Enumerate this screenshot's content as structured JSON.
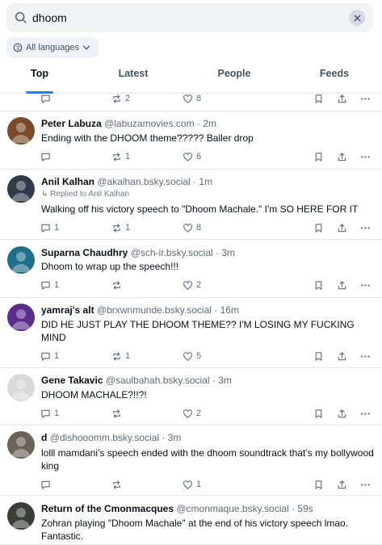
{
  "search": {
    "query": "dhoom",
    "placeholder": "Search"
  },
  "language_filter": {
    "label": "All languages"
  },
  "tabs": [
    {
      "label": "Top",
      "active": true
    },
    {
      "label": "Latest",
      "active": false
    },
    {
      "label": "People",
      "active": false
    },
    {
      "label": "Feeds",
      "active": false
    }
  ],
  "top_partial": {
    "reposts": "2",
    "likes": "8"
  },
  "posts": [
    {
      "name": "Peter Labuza",
      "handle": "@labuzamovies.com",
      "time": "2m",
      "reply_to": "",
      "text": "Ending with the DHOOM theme????? Baller drop",
      "replies": "",
      "reposts": "1",
      "likes": "6",
      "avatar_color": "#7a4b2a"
    },
    {
      "name": "Anil Kalhan",
      "handle": "@akalhan.bsky.social",
      "time": "1m",
      "reply_to": "Replied to Anil Kalhan",
      "text": "Walking off his victory speech to \"Dhoom Machale.\" I'm SO HERE FOR IT",
      "replies": "1",
      "reposts": "1",
      "likes": "8",
      "avatar_color": "#2f3b4a"
    },
    {
      "name": "Suparna Chaudhry",
      "handle": "@sch-ir.bsky.social",
      "time": "3m",
      "reply_to": "",
      "text": "Dhoom to wrap up the speech!!!",
      "replies": "1",
      "reposts": "",
      "likes": "2",
      "avatar_color": "#1f6f8b"
    },
    {
      "name": "yamraj's alt",
      "handle": "@brxwnmunde.bsky.social",
      "time": "16m",
      "reply_to": "",
      "text": "DID HE JUST PLAY THE DHOOM THEME?? I'M LOSING MY FUCKING MIND",
      "replies": "1",
      "reposts": "1",
      "likes": "5",
      "avatar_color": "#5a2d8a"
    },
    {
      "name": "Gene Takavic",
      "handle": "@saulbahah.bsky.social",
      "time": "3m",
      "reply_to": "",
      "text": "DHOOM MACHALE?!!?!",
      "replies": "1",
      "reposts": "",
      "likes": "2",
      "avatar_color": "#d9d9d9"
    },
    {
      "name": "d",
      "handle": "@dishooomm.bsky.social",
      "time": "3m",
      "reply_to": "",
      "text": "lolll mamdani’s speech ended with the dhoom soundtrack that’s my bollywood king",
      "replies": "",
      "reposts": "",
      "likes": "1",
      "avatar_color": "#6b6258"
    },
    {
      "name": "Return of the Cmonmacques",
      "handle": "@cmonmaque.bsky.social",
      "time": "59s",
      "reply_to": "",
      "text": "Zohran playing \"Dhoom Machale\" at the end of his victory speech lmao. Fantastic.",
      "replies": "",
      "reposts": "",
      "likes": "",
      "avatar_color": "#3a3f36"
    }
  ],
  "colors": {
    "accent": "#1083fe",
    "muted": "#5b6b7c",
    "border": "#e5e8ec"
  }
}
